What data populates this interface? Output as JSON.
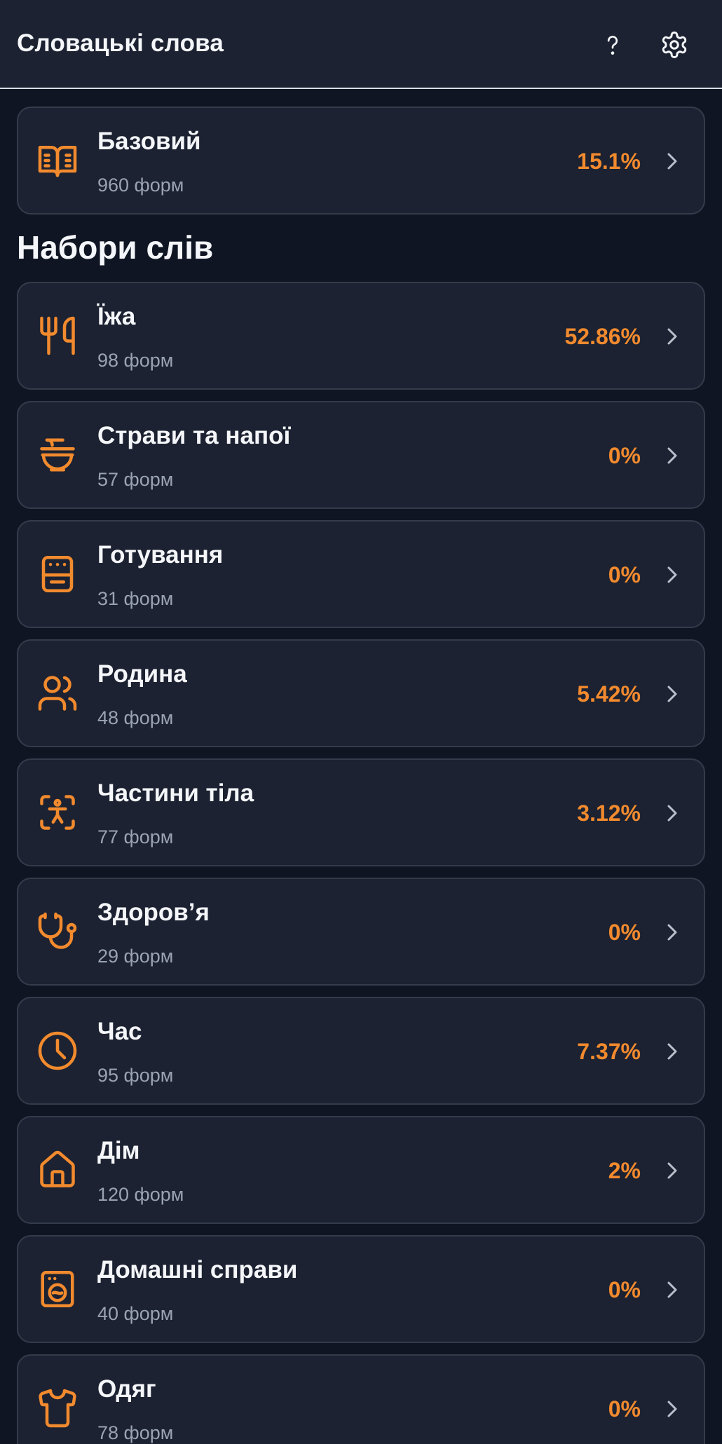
{
  "header": {
    "title": "Словацькі слова",
    "help_icon": "question-icon",
    "settings_icon": "gear-icon"
  },
  "base_deck": {
    "title": "Базовий",
    "subtitle": "960 форм",
    "progress": "15.1%",
    "icon": "book-icon"
  },
  "section": {
    "title": "Набори слів"
  },
  "sets": [
    {
      "title": "Їжа",
      "subtitle": "98 форм",
      "progress": "52.86%",
      "icon": "utensils-icon"
    },
    {
      "title": "Страви та напої",
      "subtitle": "57 форм",
      "progress": "0%",
      "icon": "bowl-icon"
    },
    {
      "title": "Готування",
      "subtitle": "31 форм",
      "progress": "0%",
      "icon": "stove-icon"
    },
    {
      "title": "Родина",
      "subtitle": "48 форм",
      "progress": "5.42%",
      "icon": "users-icon"
    },
    {
      "title": "Частини тіла",
      "subtitle": "77 форм",
      "progress": "3.12%",
      "icon": "body-scan-icon"
    },
    {
      "title": "Здоров’я",
      "subtitle": "29 форм",
      "progress": "0%",
      "icon": "stethoscope-icon"
    },
    {
      "title": "Час",
      "subtitle": "95 форм",
      "progress": "7.37%",
      "icon": "clock-icon"
    },
    {
      "title": "Дім",
      "subtitle": "120 форм",
      "progress": "2%",
      "icon": "house-icon"
    },
    {
      "title": "Домашні справи",
      "subtitle": "40 форм",
      "progress": "0%",
      "icon": "washing-machine-icon"
    },
    {
      "title": "Одяг",
      "subtitle": "78 форм",
      "progress": "0%",
      "icon": "shirt-icon"
    }
  ],
  "colors": {
    "accent": "#f28a2e",
    "background": "#0f1522",
    "card": "#1c2231",
    "card_border": "#343b4b",
    "muted_text": "#9aa3b3"
  }
}
